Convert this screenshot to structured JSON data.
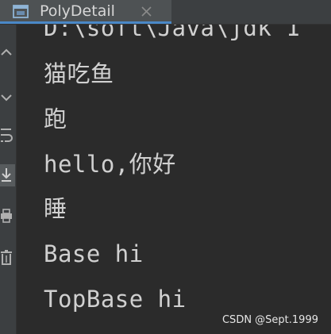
{
  "tab": {
    "title": "PolyDetail",
    "icon": "run-console-icon",
    "close_icon": "close-icon",
    "accent": "#4a88c7"
  },
  "toolbar": {
    "icons": [
      "collapse-up-icon",
      "collapse-down-icon",
      "soft-wrap-icon",
      "scroll-to-end-icon",
      "print-icon",
      "trash-icon"
    ]
  },
  "console": {
    "lines": [
      "D:\\soft\\Java\\jdk 1",
      "猫吃鱼",
      "跑",
      "hello,你好",
      "睡",
      "Base hi",
      "TopBase hi"
    ],
    "text_color": "#d0d0d0",
    "background": "#2b2b2b"
  },
  "watermark": "CSDN @Sept.1999"
}
